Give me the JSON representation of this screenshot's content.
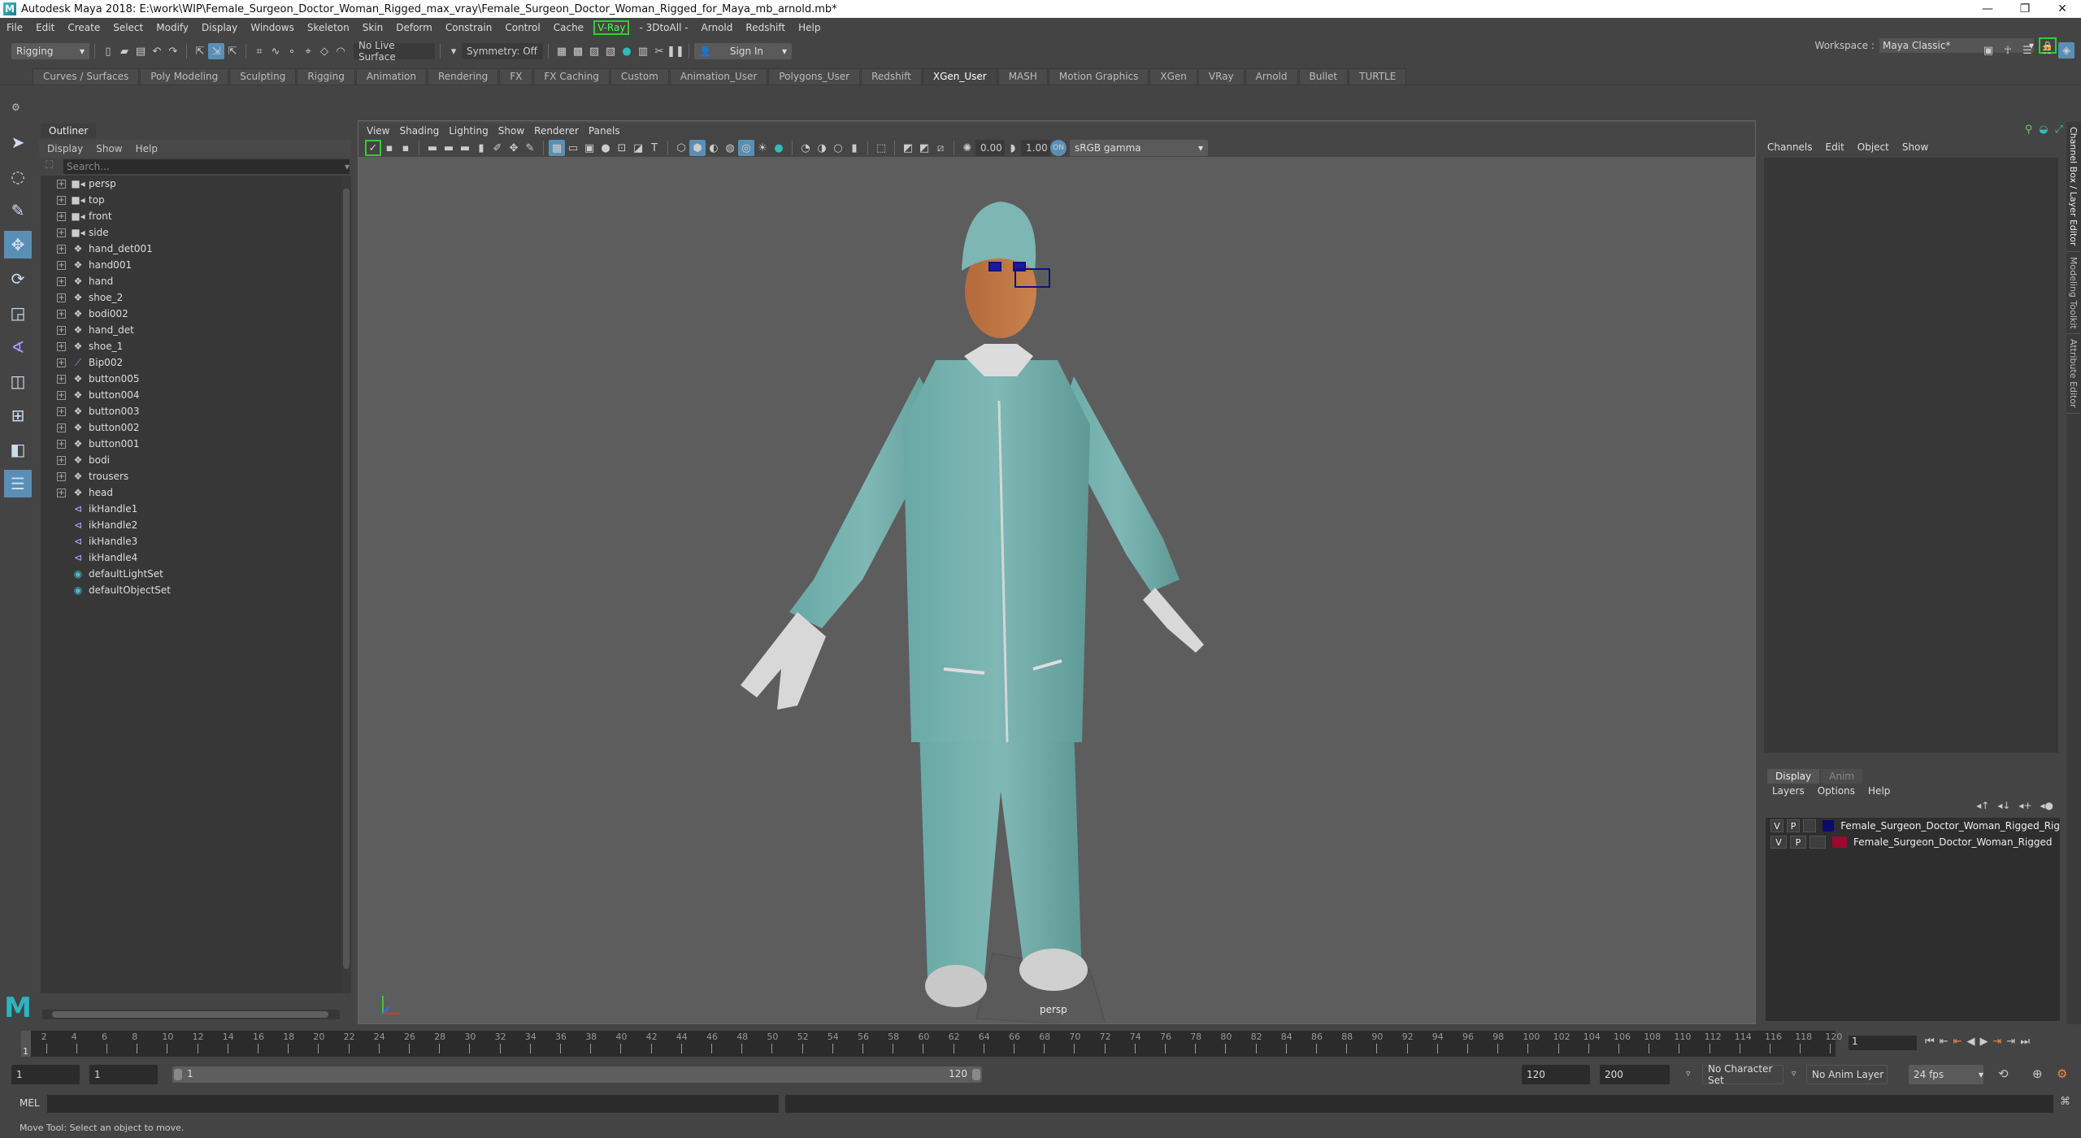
{
  "window": {
    "title": "Autodesk Maya 2018: E:\\work\\WIP\\Female_Surgeon_Doctor_Woman_Rigged_max_vray\\Female_Surgeon_Doctor_Woman_Rigged_for_Maya_mb_arnold.mb*",
    "logo": "M",
    "minimize": "—",
    "restore": "❐",
    "close": "✕"
  },
  "menubar": [
    "File",
    "Edit",
    "Create",
    "Select",
    "Modify",
    "Display",
    "Windows",
    "Skeleton",
    "Skin",
    "Deform",
    "Constrain",
    "Control",
    "Cache",
    "V-Ray",
    "- 3DtoAll -",
    "Arnold",
    "Redshift",
    "Help"
  ],
  "workspace": {
    "label": "Workspace :",
    "value": "Maya Classic*"
  },
  "toolbar": {
    "mode": "Rigging",
    "live_surface": "No Live Surface",
    "symmetry": "Symmetry: Off",
    "sign_in": "Sign In"
  },
  "shelf_tabs": [
    "Curves / Surfaces",
    "Poly Modeling",
    "Sculpting",
    "Rigging",
    "Animation",
    "Rendering",
    "FX",
    "FX Caching",
    "Custom",
    "Animation_User",
    "Polygons_User",
    "Redshift",
    "XGen_User",
    "MASH",
    "Motion Graphics",
    "XGen",
    "VRay",
    "Arnold",
    "Bullet",
    "TURTLE"
  ],
  "shelf_active": "XGen_User",
  "outliner": {
    "title": "Outliner",
    "menu": [
      "Display",
      "Show",
      "Help"
    ],
    "search_placeholder": "Search...",
    "items": [
      {
        "name": "persp",
        "type": "camera",
        "expandable": true
      },
      {
        "name": "top",
        "type": "camera",
        "expandable": true
      },
      {
        "name": "front",
        "type": "camera",
        "expandable": true
      },
      {
        "name": "side",
        "type": "camera",
        "expandable": true
      },
      {
        "name": "hand_det001",
        "type": "mesh",
        "expandable": true
      },
      {
        "name": "hand001",
        "type": "mesh",
        "expandable": true
      },
      {
        "name": "hand",
        "type": "mesh",
        "expandable": true
      },
      {
        "name": "shoe_2",
        "type": "mesh",
        "expandable": true
      },
      {
        "name": "bodi002",
        "type": "mesh",
        "expandable": true
      },
      {
        "name": "hand_det",
        "type": "mesh",
        "expandable": true
      },
      {
        "name": "shoe_1",
        "type": "mesh",
        "expandable": true
      },
      {
        "name": "Bip002",
        "type": "joint",
        "expandable": true
      },
      {
        "name": "button005",
        "type": "mesh",
        "expandable": true
      },
      {
        "name": "button004",
        "type": "mesh",
        "expandable": true
      },
      {
        "name": "button003",
        "type": "mesh",
        "expandable": true
      },
      {
        "name": "button002",
        "type": "mesh",
        "expandable": true
      },
      {
        "name": "button001",
        "type": "mesh",
        "expandable": true
      },
      {
        "name": "bodi",
        "type": "mesh",
        "expandable": true
      },
      {
        "name": "trousers",
        "type": "mesh",
        "expandable": true
      },
      {
        "name": "head",
        "type": "mesh",
        "expandable": true
      },
      {
        "name": "ikHandle1",
        "type": "ik",
        "expandable": false
      },
      {
        "name": "ikHandle2",
        "type": "ik",
        "expandable": false
      },
      {
        "name": "ikHandle3",
        "type": "ik",
        "expandable": false
      },
      {
        "name": "ikHandle4",
        "type": "ik",
        "expandable": false
      },
      {
        "name": "defaultLightSet",
        "type": "set",
        "expandable": false
      },
      {
        "name": "defaultObjectSet",
        "type": "set",
        "expandable": false
      }
    ]
  },
  "viewport": {
    "menu": [
      "View",
      "Shading",
      "Lighting",
      "Show",
      "Renderer",
      "Panels"
    ],
    "exposure": "0.00",
    "gamma": "1.00",
    "color_space": "sRGB gamma",
    "camera_label": "persp"
  },
  "channel_box": {
    "menu": [
      "Channels",
      "Edit",
      "Object",
      "Show"
    ]
  },
  "side_tabs": [
    "Channel Box / Layer Editor",
    "Modeling Toolkit",
    "Attribute Editor"
  ],
  "layer_editor": {
    "tabs": [
      "Display",
      "Anim"
    ],
    "active_tab": "Display",
    "menu": [
      "Layers",
      "Options",
      "Help"
    ],
    "layers": [
      {
        "v": "V",
        "p": "P",
        "color": "#0a0a6e",
        "name": "Female_Surgeon_Doctor_Woman_Rigged_Rig"
      },
      {
        "v": "V",
        "p": "P",
        "color": "#9a0a2e",
        "name": "Female_Surgeon_Doctor_Woman_Rigged"
      }
    ]
  },
  "timeline": {
    "ticks": [
      "2",
      "4",
      "6",
      "8",
      "10",
      "12",
      "14",
      "16",
      "18",
      "20",
      "22",
      "24",
      "26",
      "28",
      "30",
      "32",
      "34",
      "36",
      "38",
      "40",
      "42",
      "44",
      "46",
      "48",
      "50",
      "52",
      "54",
      "56",
      "58",
      "60",
      "62",
      "64",
      "66",
      "68",
      "70",
      "72",
      "74",
      "76",
      "78",
      "80",
      "82",
      "84",
      "86",
      "88",
      "90",
      "92",
      "94",
      "96",
      "98",
      "100",
      "102",
      "104",
      "106",
      "108",
      "110",
      "112",
      "114",
      "116",
      "118",
      "120"
    ],
    "current_frame": "1",
    "current_frame_field": "1",
    "range_min": 1,
    "range_max": 120
  },
  "range": {
    "start": "1",
    "inner_start": "1",
    "slider_start": "1",
    "slider_end": "120",
    "end": "120",
    "outer_end": "200",
    "character_set": "No Character Set",
    "anim_layer": "No Anim Layer",
    "fps": "24 fps"
  },
  "mel": {
    "label": "MEL"
  },
  "help_line": "Move Tool: Select an object to move."
}
